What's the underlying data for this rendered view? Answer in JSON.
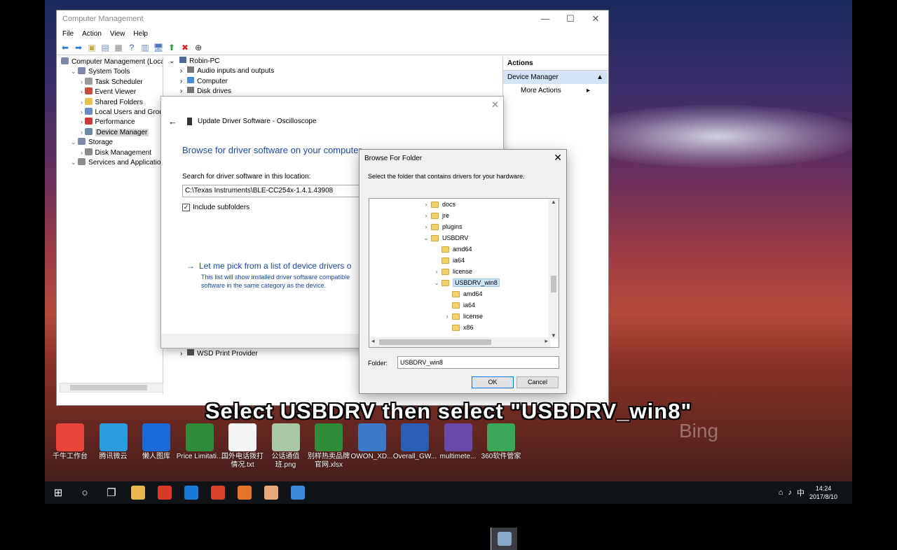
{
  "desktop": {
    "icons": [
      {
        "label": "千牛工作台",
        "color": "#e8443a"
      },
      {
        "label": "腾讯微云",
        "color": "#2c9be0"
      },
      {
        "label": "懒人图库",
        "color": "#1a6ad8"
      },
      {
        "label": "Price Limitati...",
        "color": "#2e8b3a"
      },
      {
        "label": "国外电话拨打情况.txt",
        "color": "#f4f4f4"
      },
      {
        "label": "公话通值班.png",
        "color": "#a8c8a8"
      },
      {
        "label": "别样热卖品牌官网.xlsx",
        "color": "#2e8b3a"
      },
      {
        "label": "OWON_XD...",
        "color": "#3a7ac8"
      },
      {
        "label": "Overall_GW...",
        "color": "#2b5fb4"
      },
      {
        "label": "multimete...",
        "color": "#6a4aa8"
      },
      {
        "label": "360软件管家",
        "color": "#3aa858"
      }
    ],
    "bing": "Bing"
  },
  "window": {
    "title": "Computer Management",
    "menu": [
      "File",
      "Action",
      "View",
      "Help"
    ],
    "tree": [
      {
        "label": "Computer Management (Local",
        "indent": 0,
        "color": "#7a8aa8"
      },
      {
        "label": "System Tools",
        "indent": 1,
        "color": "#7a8aa8"
      },
      {
        "label": "Task Scheduler",
        "indent": 2,
        "color": "#9a9a9a"
      },
      {
        "label": "Event Viewer",
        "indent": 2,
        "color": "#c84a3a"
      },
      {
        "label": "Shared Folders",
        "indent": 2,
        "color": "#e8c04a"
      },
      {
        "label": "Local Users and Groups",
        "indent": 2,
        "color": "#6a8ac8"
      },
      {
        "label": "Performance",
        "indent": 2,
        "color": "#c83a3a"
      },
      {
        "label": "Device Manager",
        "indent": 2,
        "color": "#6a8aa8",
        "selected": true
      },
      {
        "label": "Storage",
        "indent": 1,
        "color": "#7a8aa8"
      },
      {
        "label": "Disk Management",
        "indent": 2,
        "color": "#8a8a8a"
      },
      {
        "label": "Services and Applications",
        "indent": 1,
        "color": "#8a8a8a"
      }
    ],
    "devices": {
      "root": "Robin-PC",
      "items": [
        "Audio inputs and outputs",
        "Computer",
        "Disk drives"
      ],
      "last": "WSD Print Provider"
    },
    "actions": {
      "header": "Actions",
      "selected": "Device Manager",
      "more": "More Actions"
    }
  },
  "update_dialog": {
    "title": "Update Driver Software - Oscilloscope",
    "heading": "Browse for driver software on your computer",
    "search_label": "Search for driver software in this location:",
    "path": "C:\\Texas Instruments\\BLE-CC254x-1.4.1.43908",
    "include_subfolders": "Include subfolders",
    "pick_link": "Let me pick from a list of device drivers o",
    "pick_desc": "This list will show installed driver software compatible software in the same category as the device."
  },
  "browse_dialog": {
    "title": "Browse For Folder",
    "instruction": "Select the folder that contains drivers for your hardware.",
    "folders": [
      {
        "name": "docs",
        "level": 0,
        "arrow": "›"
      },
      {
        "name": "jre",
        "level": 0,
        "arrow": "›"
      },
      {
        "name": "plugins",
        "level": 0,
        "arrow": "›"
      },
      {
        "name": "USBDRV",
        "level": 0,
        "arrow": "⌄"
      },
      {
        "name": "amd64",
        "level": 1,
        "arrow": ""
      },
      {
        "name": "ia64",
        "level": 1,
        "arrow": ""
      },
      {
        "name": "license",
        "level": 1,
        "arrow": "›"
      },
      {
        "name": "USBDRV_win8",
        "level": 1,
        "arrow": "⌄",
        "selected": true
      },
      {
        "name": "amd64",
        "level": 2,
        "arrow": ""
      },
      {
        "name": "ia64",
        "level": 2,
        "arrow": ""
      },
      {
        "name": "license",
        "level": 2,
        "arrow": "›"
      },
      {
        "name": "x86",
        "level": 2,
        "arrow": ""
      }
    ],
    "folder_label": "Folder:",
    "folder_value": "USBDRV_win8",
    "ok": "OK",
    "cancel": "Cancel"
  },
  "caption": "Select USBDRV then select \"USBDRV_win8\"",
  "taskbar": {
    "apps": [
      {
        "name": "start",
        "glyph": "⊞"
      },
      {
        "name": "search",
        "glyph": "○"
      },
      {
        "name": "task-view",
        "glyph": "❐"
      },
      {
        "name": "file-explorer",
        "color": "#e8b84a"
      },
      {
        "name": "app-red",
        "color": "#d83a2a"
      },
      {
        "name": "edge",
        "color": "#1a7ad8"
      },
      {
        "name": "app-orange",
        "color": "#d8442a"
      },
      {
        "name": "firefox",
        "color": "#e8742a"
      },
      {
        "name": "chrome",
        "color": "#3aa858",
        "active": true
      },
      {
        "name": "app-face",
        "color": "#e8a87a"
      },
      {
        "name": "app-files",
        "color": "#3a8ad8"
      },
      {
        "name": "computer-management",
        "color": "#8aa8c8",
        "active": true
      }
    ],
    "tray_lang": "中",
    "time": "14:24",
    "date": "2017/8/10"
  }
}
